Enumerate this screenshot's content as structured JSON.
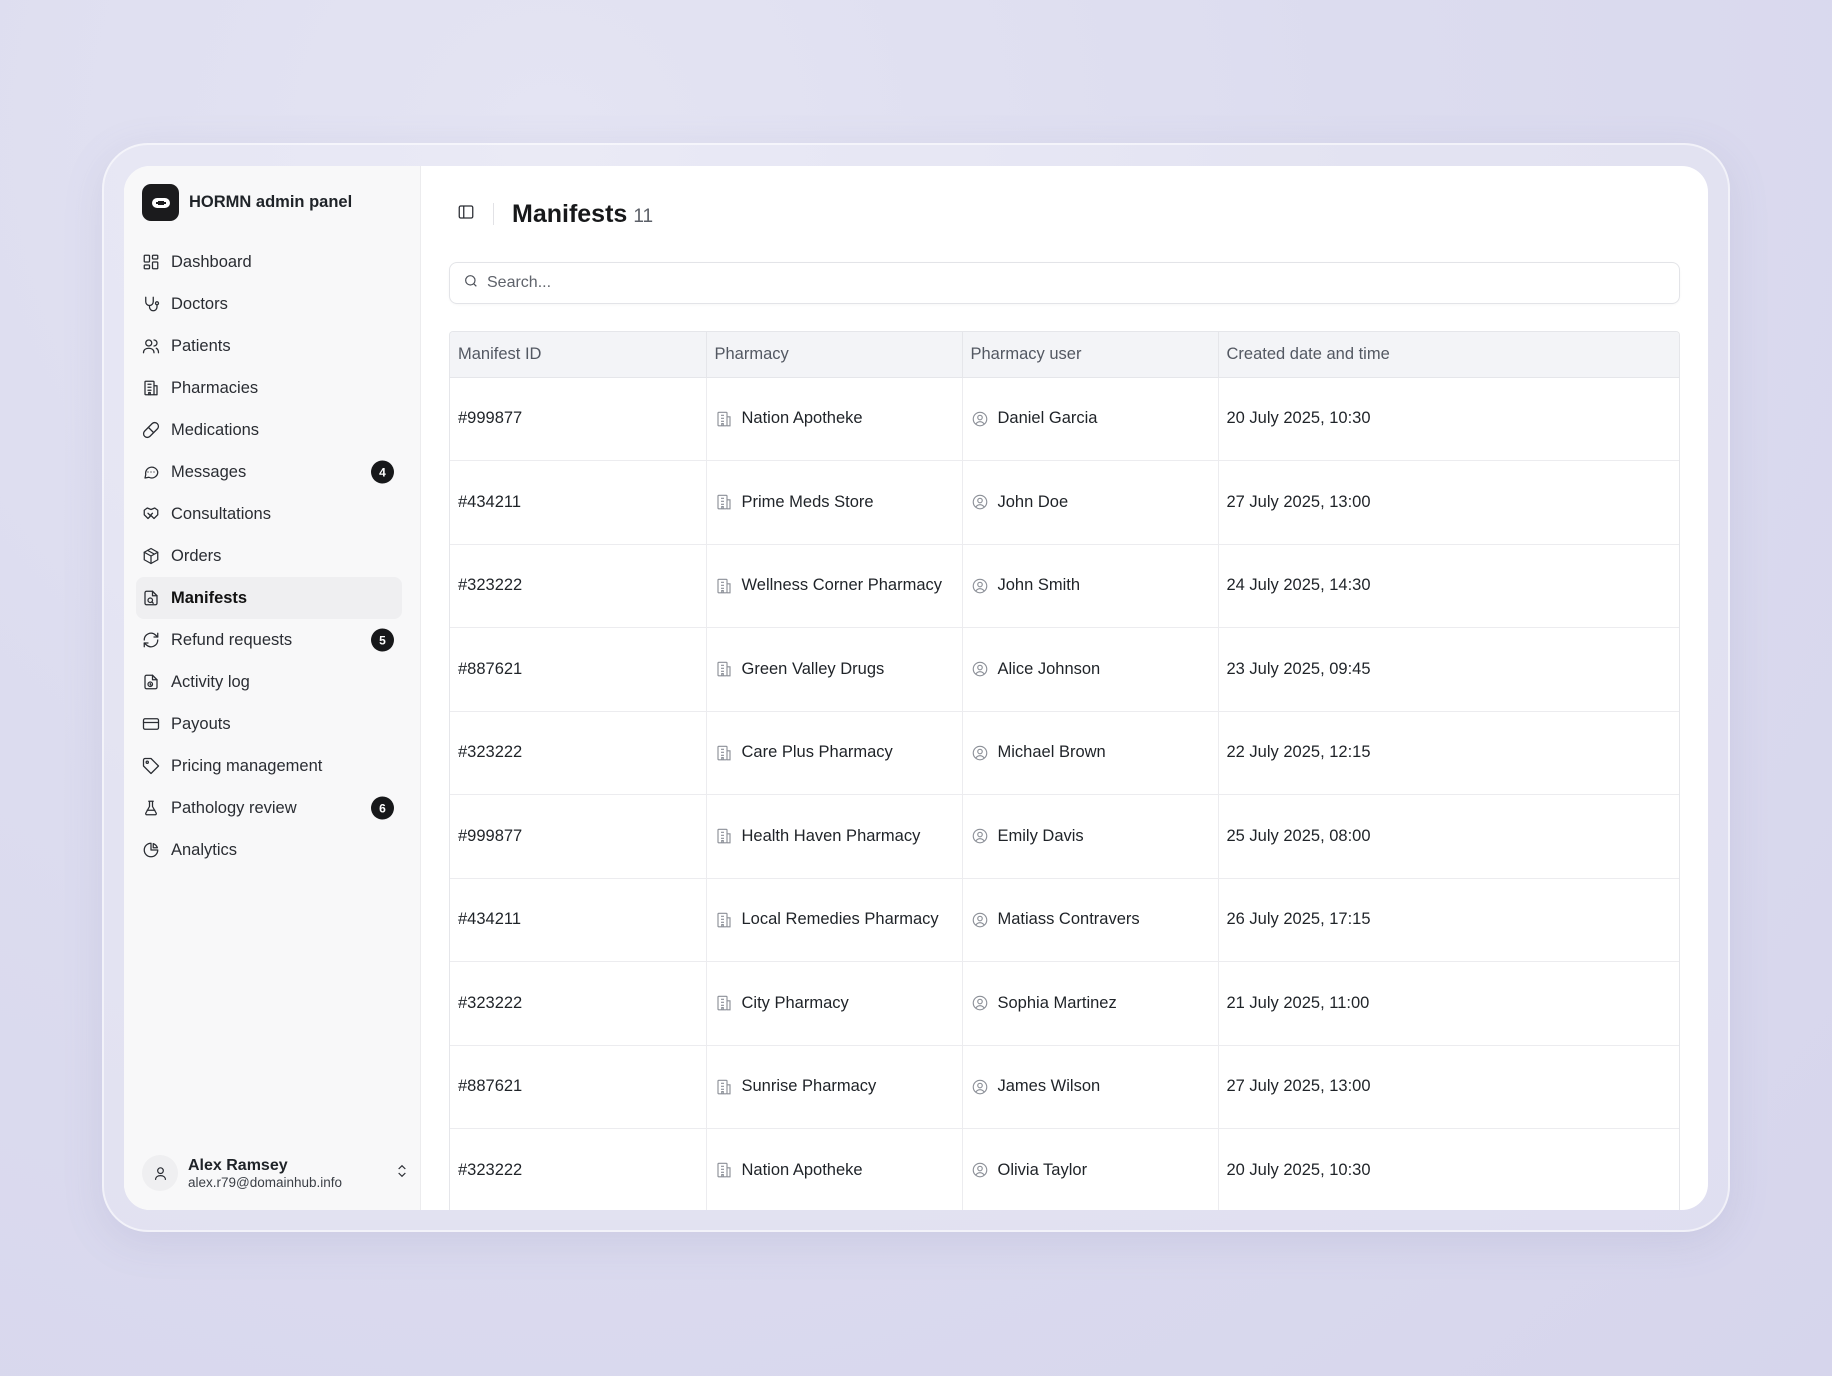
{
  "brand": {
    "name": "HORMN admin panel"
  },
  "sidebar": {
    "items": [
      {
        "label": "Dashboard",
        "icon": "dashboard-icon"
      },
      {
        "label": "Doctors",
        "icon": "stethoscope-icon"
      },
      {
        "label": "Patients",
        "icon": "users-icon"
      },
      {
        "label": "Pharmacies",
        "icon": "building-icon"
      },
      {
        "label": "Medications",
        "icon": "pill-icon"
      },
      {
        "label": "Messages",
        "icon": "message-icon",
        "badge": "4"
      },
      {
        "label": "Consultations",
        "icon": "handshake-icon"
      },
      {
        "label": "Orders",
        "icon": "package-icon"
      },
      {
        "label": "Manifests",
        "icon": "manifest-icon",
        "active": true
      },
      {
        "label": "Refund requests",
        "icon": "refresh-icon",
        "badge": "5"
      },
      {
        "label": "Activity log",
        "icon": "activity-log-icon"
      },
      {
        "label": "Payouts",
        "icon": "credit-card-icon"
      },
      {
        "label": "Pricing management",
        "icon": "tag-icon"
      },
      {
        "label": "Pathology review",
        "icon": "flask-icon",
        "badge": "6"
      },
      {
        "label": "Analytics",
        "icon": "pie-chart-icon"
      }
    ]
  },
  "user": {
    "name": "Alex Ramsey",
    "email": "alex.r79@domainhub.info"
  },
  "header": {
    "title": "Manifests",
    "count": "11"
  },
  "search": {
    "placeholder": "Search..."
  },
  "table": {
    "columns": [
      "Manifest ID",
      "Pharmacy",
      "Pharmacy user",
      "Created date and time"
    ],
    "rows": [
      {
        "id": "#999877",
        "pharmacy": "Nation Apotheke",
        "user": "Daniel Garcia",
        "created": "20 July 2025, 10:30"
      },
      {
        "id": "#434211",
        "pharmacy": "Prime Meds Store",
        "user": "John Doe",
        "created": "27 July 2025, 13:00"
      },
      {
        "id": "#323222",
        "pharmacy": "Wellness Corner Pharmacy",
        "user": "John Smith",
        "created": "24 July 2025, 14:30"
      },
      {
        "id": "#887621",
        "pharmacy": "Green Valley Drugs",
        "user": "Alice Johnson",
        "created": "23 July 2025, 09:45"
      },
      {
        "id": "#323222",
        "pharmacy": "Care Plus Pharmacy",
        "user": "Michael Brown",
        "created": "22 July 2025, 12:15"
      },
      {
        "id": "#999877",
        "pharmacy": "Health Haven Pharmacy",
        "user": "Emily Davis",
        "created": "25 July 2025, 08:00"
      },
      {
        "id": "#434211",
        "pharmacy": "Local Remedies Pharmacy",
        "user": "Matiass Contravers",
        "created": "26 July 2025, 17:15"
      },
      {
        "id": "#323222",
        "pharmacy": "City Pharmacy",
        "user": "Sophia Martinez",
        "created": "21 July 2025, 11:00"
      },
      {
        "id": "#887621",
        "pharmacy": "Sunrise Pharmacy",
        "user": "James Wilson",
        "created": "27 July 2025, 13:00"
      },
      {
        "id": "#323222",
        "pharmacy": "Nation Apotheke",
        "user": "Olivia Taylor",
        "created": "20 July 2025, 10:30"
      }
    ]
  }
}
